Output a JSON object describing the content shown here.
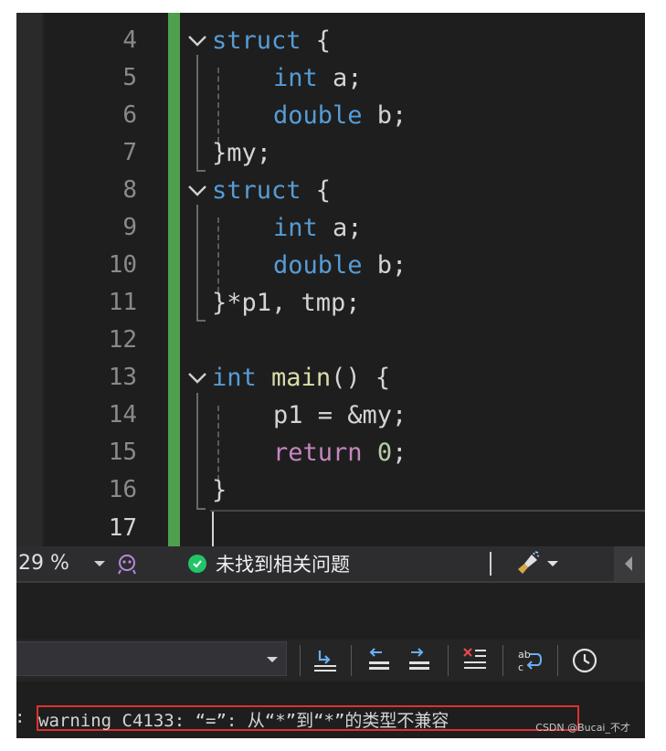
{
  "editor": {
    "line_numbers": [
      "4",
      "5",
      "6",
      "7",
      "8",
      "9",
      "10",
      "11",
      "12",
      "13",
      "14",
      "15",
      "16",
      "17"
    ],
    "current_line": "17",
    "lines": {
      "l4": {
        "kw": "struct",
        "rest": " {"
      },
      "l5": {
        "kw": "int",
        "rest": " a;"
      },
      "l6": {
        "kw": "double",
        "rest": " b;"
      },
      "l7": {
        "text": "}my;"
      },
      "l8": {
        "kw": "struct",
        "rest": " {"
      },
      "l9": {
        "kw": "int",
        "rest": " a;"
      },
      "l10": {
        "kw": "double",
        "rest": " b;"
      },
      "l11": {
        "text": "}*p1, tmp;"
      },
      "l13": {
        "kw": "int",
        "fn": "main",
        "rest": "() {"
      },
      "l14": {
        "text": "p1 = &my;"
      },
      "l15": {
        "ctl": "return",
        "num": "0",
        "rest": ";"
      },
      "l16": {
        "text": "}"
      }
    }
  },
  "status": {
    "zoom": "29 %",
    "issues_text": "未找到相关问题"
  },
  "output": {
    "prefix": ":",
    "warning": "warning C4133: “=”: 从“*”到“*”的类型不兼容"
  },
  "watermark": "CSDN @Bucai_不才",
  "colors": {
    "keyword": "#569cd6",
    "control": "#c586c0",
    "function": "#dcdcaa",
    "number": "#b5cea8",
    "change_bar": "#4ea04e",
    "warning_border": "#e03030",
    "ok": "#23c467"
  },
  "icons": [
    "chevron-down-icon",
    "copilot-icon",
    "check-circle-icon",
    "cleanup-brush-icon",
    "scroll-left-icon",
    "go-to-location-icon",
    "prev-message-icon",
    "next-message-icon",
    "clear-all-icon",
    "word-wrap-icon",
    "history-clock-icon"
  ]
}
